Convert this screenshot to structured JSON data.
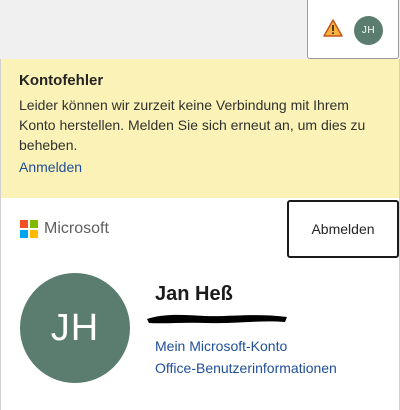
{
  "header": {
    "warning_icon": "warning-triangle-icon",
    "avatar_initials": "JH"
  },
  "banner": {
    "title": "Kontofehler",
    "message": "Leider können wir zurzeit keine Verbindung mit Ihrem Konto herstellen. Melden Sie sich erneut an, um dies zu beheben.",
    "link": "Anmelden",
    "background_color": "#fbf2b7"
  },
  "brand": {
    "name": "Microsoft",
    "logo_colors": [
      "#f25022",
      "#7fba00",
      "#00a4ef",
      "#ffb900"
    ]
  },
  "account": {
    "signout_label": "Abmelden",
    "avatar_initials": "JH",
    "avatar_color": "#5a7d6f",
    "name": "Jan Heß",
    "links": [
      "Mein Microsoft-Konto",
      "Office-Benutzerinformationen"
    ]
  },
  "colors": {
    "link": "#1f4e99"
  }
}
